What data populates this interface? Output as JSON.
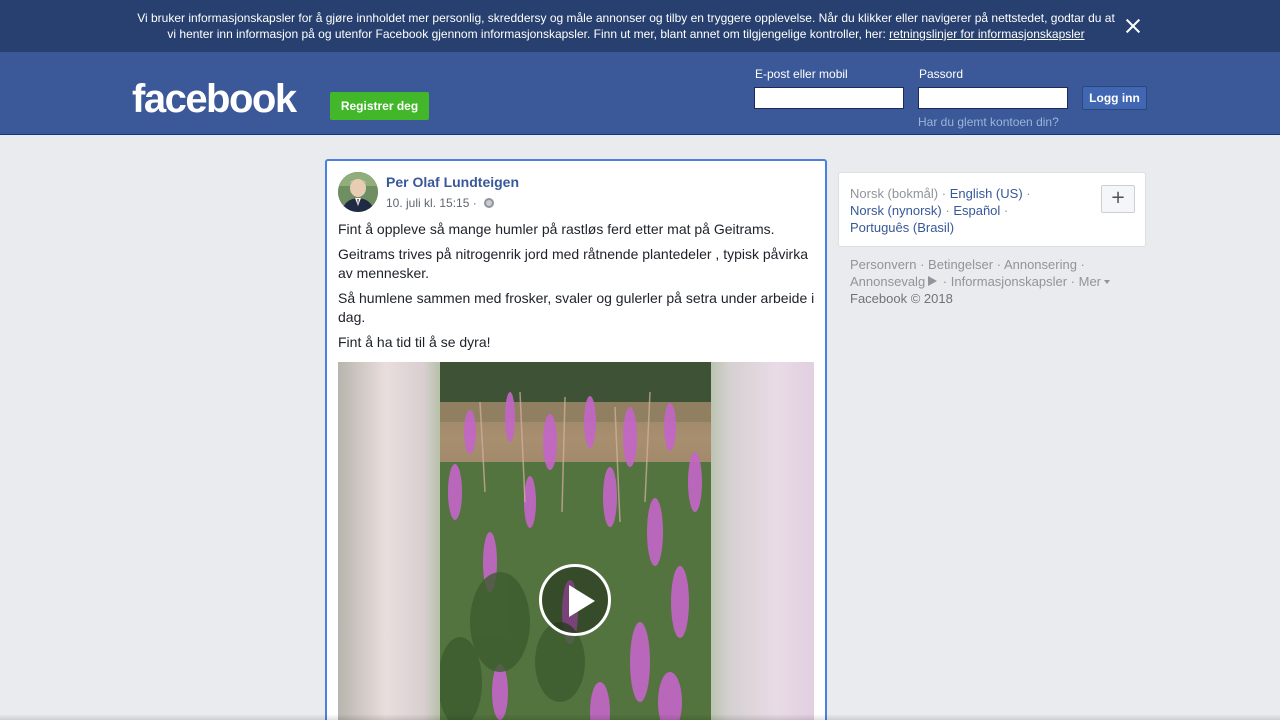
{
  "cookie_banner": {
    "text_line1": "Vi bruker informasjonskapsler for å gjøre innholdet mer personlig, skreddersy og måle annonser og tilby en tryggere opplevelse. Når du klikker eller navigerer på nettstedet, godtar du at",
    "text_line2": "vi henter inn informasjon på og utenfor Facebook gjennom informasjonskapsler. Finn ut mer, blant annet om tilgjengelige kontroller, her:",
    "link": "retningslinjer for informasjonskapsler",
    "close_icon": "close-icon"
  },
  "header": {
    "logo": "facebook",
    "register_label": "Registrer deg",
    "email_label": "E-post eller mobil",
    "email_value": "",
    "password_label": "Passord",
    "password_value": "",
    "login_label": "Logg inn",
    "forgot_link": "Har du glemt kontoen din?"
  },
  "post": {
    "author": "Per Olaf Lundteigen",
    "date": "10. juli kl. 15:15",
    "separator": " · ",
    "privacy_icon": "globe-icon",
    "paragraphs": [
      "Fint å oppleve så mange humler på rastløs ferd etter mat på Geitrams.",
      "Geitrams trives på nitrogenrik jord med råtnende plantedeler , typisk påvirka av mennesker.",
      "Så humlene sammen med frosker, svaler og gulerler på setra under arbeide i dag.",
      "Fint å ha tid til å se dyra!"
    ],
    "video_icon": "play-icon"
  },
  "languages": {
    "current": "Norsk (bokmål)",
    "links": [
      "English (US)",
      "Norsk (nynorsk)",
      "Español",
      "Português (Brasil)"
    ],
    "add_button": "+"
  },
  "footer": {
    "links": [
      "Personvern",
      "Betingelser",
      "Annonsering",
      "Annonsevalg",
      "Informasjonskapsler",
      "Mer"
    ],
    "copyright": "Facebook © 2018",
    "adchoice_icon": "adchoices-icon"
  }
}
